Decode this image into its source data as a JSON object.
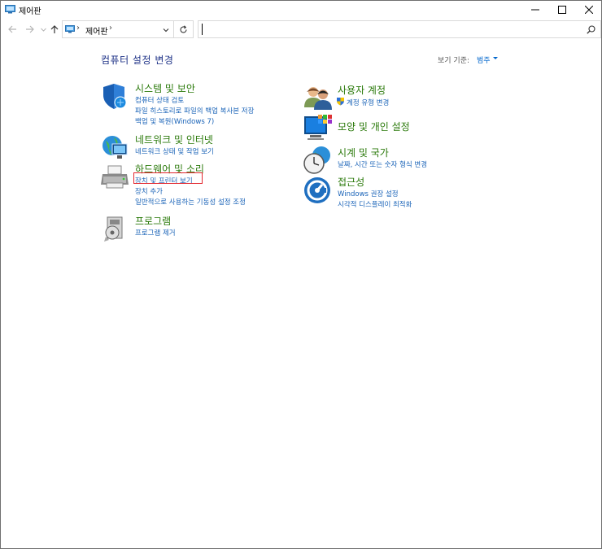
{
  "window": {
    "title": "제어판"
  },
  "address": {
    "crumb": "제어판",
    "separator": "›"
  },
  "search": {
    "placeholder": ""
  },
  "content": {
    "title": "컴퓨터 설정 변경",
    "view_by_label": "보기 기준:",
    "view_by_value": "범주"
  },
  "categories": [
    {
      "heading": "시스템 및 보안",
      "icon": "shield-icon",
      "links": [
        "컴퓨터 상태 검토",
        "파일 히스토리로 파일의 백업 복사본 저장",
        "백업 및 복원(Windows 7)"
      ]
    },
    {
      "heading": "네트워크 및 인터넷",
      "icon": "network-globe-icon",
      "links": [
        "네트워크 상태 및 작업 보기"
      ]
    },
    {
      "heading": "하드웨어 및 소리",
      "icon": "printer-icon",
      "links": [
        "장치 및 프린터 보기",
        "장치 추가",
        "일반적으로 사용하는 기동성 설정 조정"
      ]
    },
    {
      "heading": "프로그램",
      "icon": "programs-icon",
      "links": [
        "프로그램 제거"
      ]
    },
    {
      "heading": "사용자 계정",
      "icon": "users-icon",
      "links": [
        "계정 유형 변경"
      ]
    },
    {
      "heading": "모양 및 개인 설정",
      "icon": "appearance-icon",
      "links": []
    },
    {
      "heading": "시계 및 국가",
      "icon": "clock-globe-icon",
      "links": [
        "날짜, 시간 또는 숫자 형식 변경"
      ]
    },
    {
      "heading": "접근성",
      "icon": "accessibility-icon",
      "links": [
        "Windows 권장 설정",
        "시각적 디스플레이 최적화"
      ]
    }
  ],
  "colors": {
    "heading": "#2b7a0b",
    "link": "#1b64b8",
    "title": "#1e3287",
    "highlight": "#e3262e"
  }
}
